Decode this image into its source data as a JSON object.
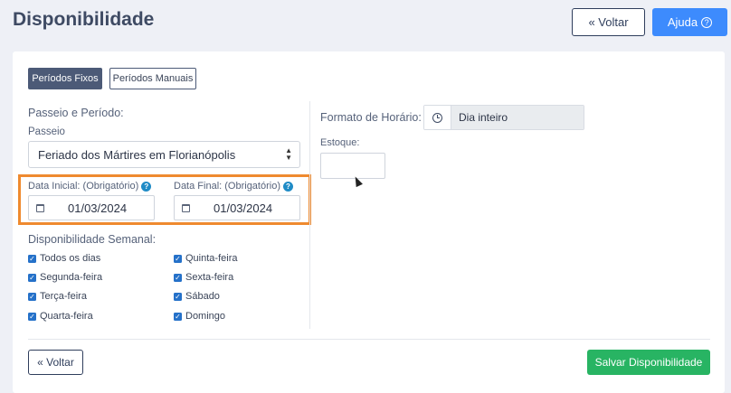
{
  "header": {
    "title": "Disponibilidade",
    "voltar_label": "« Voltar",
    "ajuda_label": "Ajuda",
    "ajuda_icon": "?"
  },
  "tabs": {
    "fixos": "Períodos Fixos",
    "manuais": "Períodos Manuais"
  },
  "form": {
    "section_title": "Passeio e Período:",
    "passeio_label": "Passeio",
    "passeio_value": "Feriado dos Mártires em Florianópolis",
    "data_inicial_label": "Data Inicial: (Obrigatório)",
    "data_inicial_value": "01/03/2024",
    "data_final_label": "Data Final: (Obrigatório)",
    "data_final_value": "01/03/2024",
    "formato_label": "Formato de Horário:",
    "formato_value": "Dia inteiro",
    "estoque_label": "Estoque:",
    "estoque_value": ""
  },
  "semanal": {
    "title": "Disponibilidade Semanal:",
    "left": [
      "Todos os dias",
      "Segunda-feira",
      "Terça-feira",
      "Quarta-feira"
    ],
    "right": [
      "Quinta-feira",
      "Sexta-feira",
      "Sábado",
      "Domingo"
    ]
  },
  "footer": {
    "voltar_label": "« Voltar",
    "salvar_label": "Salvar Disponibilidade"
  },
  "colors": {
    "highlight": "#ef8a2f",
    "primary": "#3d8bfd",
    "success": "#28b463",
    "dark": "#4c5a77"
  }
}
